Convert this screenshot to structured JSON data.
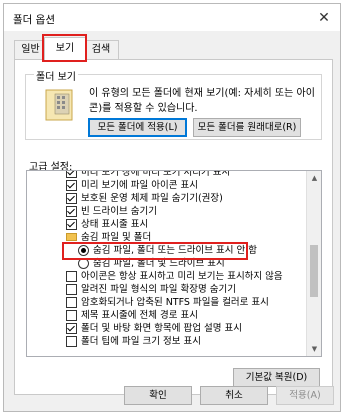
{
  "window": {
    "title": "폴더 옵션",
    "close_glyph": "✕"
  },
  "tabs": [
    {
      "label": "일반",
      "active": false
    },
    {
      "label": "보기",
      "active": true
    },
    {
      "label": "검색",
      "active": false
    }
  ],
  "folder_view": {
    "group_label": "폴더 보기",
    "description": "이 유형의 모든 폴더에 현재 보기(예: 자세히 또는 아이콘)를 적용할 수 있습니다.",
    "apply_button": "모든 폴더에 적용(L)",
    "reset_button": "모든 폴더를 원래대로(R)"
  },
  "advanced": {
    "label": "고급 설정:",
    "items": [
      {
        "type": "checkbox",
        "checked": true,
        "label": "미리 보기 창에 미리 보기 처리기 표시"
      },
      {
        "type": "checkbox",
        "checked": true,
        "label": "미리 보기에 파일 아이콘 표시"
      },
      {
        "type": "checkbox",
        "checked": true,
        "label": "보호된 운영 체제 파일 숨기기(권장)"
      },
      {
        "type": "checkbox",
        "checked": true,
        "label": "빈 드라이브 숨기기"
      },
      {
        "type": "checkbox",
        "checked": true,
        "label": "상태 표시줄 표시"
      },
      {
        "type": "folder",
        "checked": false,
        "label": "숨김 파일 및 폴더"
      },
      {
        "type": "radio",
        "checked": true,
        "label": "숨김 파일, 폴더 또는 드라이브 표시 안 함"
      },
      {
        "type": "radio",
        "checked": false,
        "label": "숨김 파일, 폴더 및 드라이브 표시"
      },
      {
        "type": "checkbox",
        "checked": false,
        "label": "아이콘은 항상 표시하고 미리 보기는 표시하지 않음"
      },
      {
        "type": "checkbox",
        "checked": false,
        "label": "알려진 파일 형식의 파일 확장명 숨기기"
      },
      {
        "type": "checkbox",
        "checked": false,
        "label": "암호화되거나 압축된 NTFS 파일을 컬러로 표시"
      },
      {
        "type": "checkbox",
        "checked": false,
        "label": "제목 표시줄에 전체 경로 표시"
      },
      {
        "type": "checkbox",
        "checked": true,
        "label": "폴더 및 바탕 화면 항목에 팝업 설명 표시"
      },
      {
        "type": "checkbox",
        "checked": false,
        "label": "폴더 팁에 파일 크기 정보 표시"
      }
    ],
    "restore_button": "기본값 복원(D)"
  },
  "footer": {
    "ok": "확인",
    "cancel": "취소",
    "apply": "적용(A)"
  },
  "colors": {
    "highlight_box": "#e0201e",
    "focus": "#0078d7"
  }
}
